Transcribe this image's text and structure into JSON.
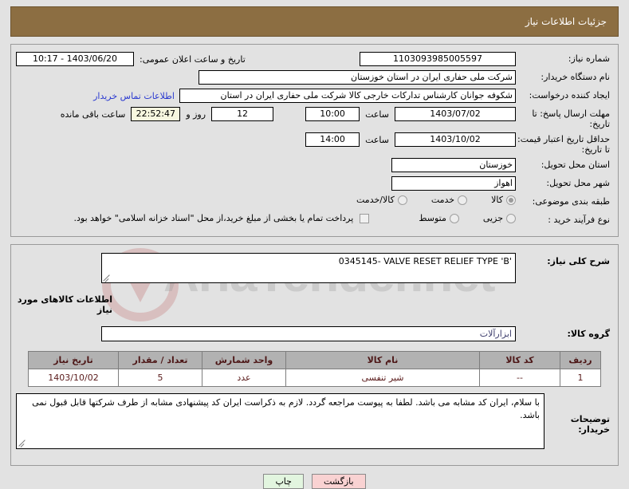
{
  "header": {
    "title": "جزئیات اطلاعات نیاز"
  },
  "form": {
    "need_number": {
      "label": "شماره نیاز:",
      "value": "1103093985005597"
    },
    "announce_date": {
      "label": "تاریخ و ساعت اعلان عمومی:",
      "value": "1403/06/20 - 10:17"
    },
    "buyer_org": {
      "label": "نام دستگاه خریدار:",
      "value": "شرکت ملی حفاری ایران در استان خوزستان"
    },
    "creator": {
      "label": "ایجاد کننده درخواست:",
      "value": "شکوفه جوانان کارشناس تدارکات خارجی کالا شرکت ملی حفاری ایران در استان",
      "contact_link": "اطلاعات تماس خریدار"
    },
    "response_deadline": {
      "label": "مهلت ارسال پاسخ: تا تاریخ:",
      "date": "1403/07/02",
      "hour_label": "ساعت",
      "hour": "10:00",
      "days": "12",
      "days_suffix": "روز و",
      "countdown": "22:52:47",
      "countdown_suffix": "ساعت باقی مانده"
    },
    "price_validity": {
      "label": "حداقل تاریخ اعتبار قیمت: تا تاریخ:",
      "date": "1403/10/02",
      "hour_label": "ساعت",
      "hour": "14:00"
    },
    "delivery_province": {
      "label": "استان محل تحویل:",
      "value": "خوزستان"
    },
    "delivery_city": {
      "label": "شهر محل تحویل:",
      "value": "اهواز"
    },
    "subject_class": {
      "label": "طبقه بندی موضوعی:",
      "options": [
        {
          "label": "کالا",
          "selected": true
        },
        {
          "label": "خدمت",
          "selected": false
        },
        {
          "label": "کالا/خدمت",
          "selected": false
        }
      ]
    },
    "purchase_process": {
      "label": "نوع فرآیند خرید :",
      "options": [
        {
          "label": "جزیی",
          "selected": false
        },
        {
          "label": "متوسط",
          "selected": false
        }
      ],
      "checkbox_label": "پرداخت تمام یا بخشی از مبلغ خرید،از محل \"اسناد خزانه اسلامی\" خواهد بود.",
      "checkbox_checked": false
    }
  },
  "description": {
    "label": "شرح کلی نیاز:",
    "value": "0345145- VALVE RESET RELIEF TYPE  'B'"
  },
  "goods_section": {
    "title": "اطلاعات کالاهای مورد نیاز",
    "group_label": "گروه کالا:",
    "group_value": "ابزارآلات"
  },
  "items_table": {
    "headers": [
      "ردیف",
      "کد کالا",
      "نام کالا",
      "واحد شمارش",
      "تعداد / مقدار",
      "تاریخ نیاز"
    ],
    "rows": [
      [
        "1",
        "--",
        "شیر تنفسی",
        "عدد",
        "5",
        "1403/10/02"
      ]
    ]
  },
  "buyer_notes": {
    "label": "توضیحات خریدار:",
    "value": "با سلام، ایران کد مشابه می باشد. لطفا به پیوست مراجعه گردد. لازم به ذکراست ایران کد پیشنهادی مشابه از طرف شرکتها قابل قبول نمی باشد."
  },
  "footer": {
    "back_label": "بازگشت",
    "print_label": "چاپ"
  },
  "watermark": {
    "text": "AriaTender.net"
  },
  "colors": {
    "header_bg": "#8c6e42",
    "link": "#2a39d0",
    "table_header_bg": "#b2b2b2",
    "table_text": "#5a1b1b",
    "countdown_bg": "#f7f7df",
    "back_btn_bg": "#f9d2d2",
    "print_btn_bg": "#e2f5df"
  }
}
